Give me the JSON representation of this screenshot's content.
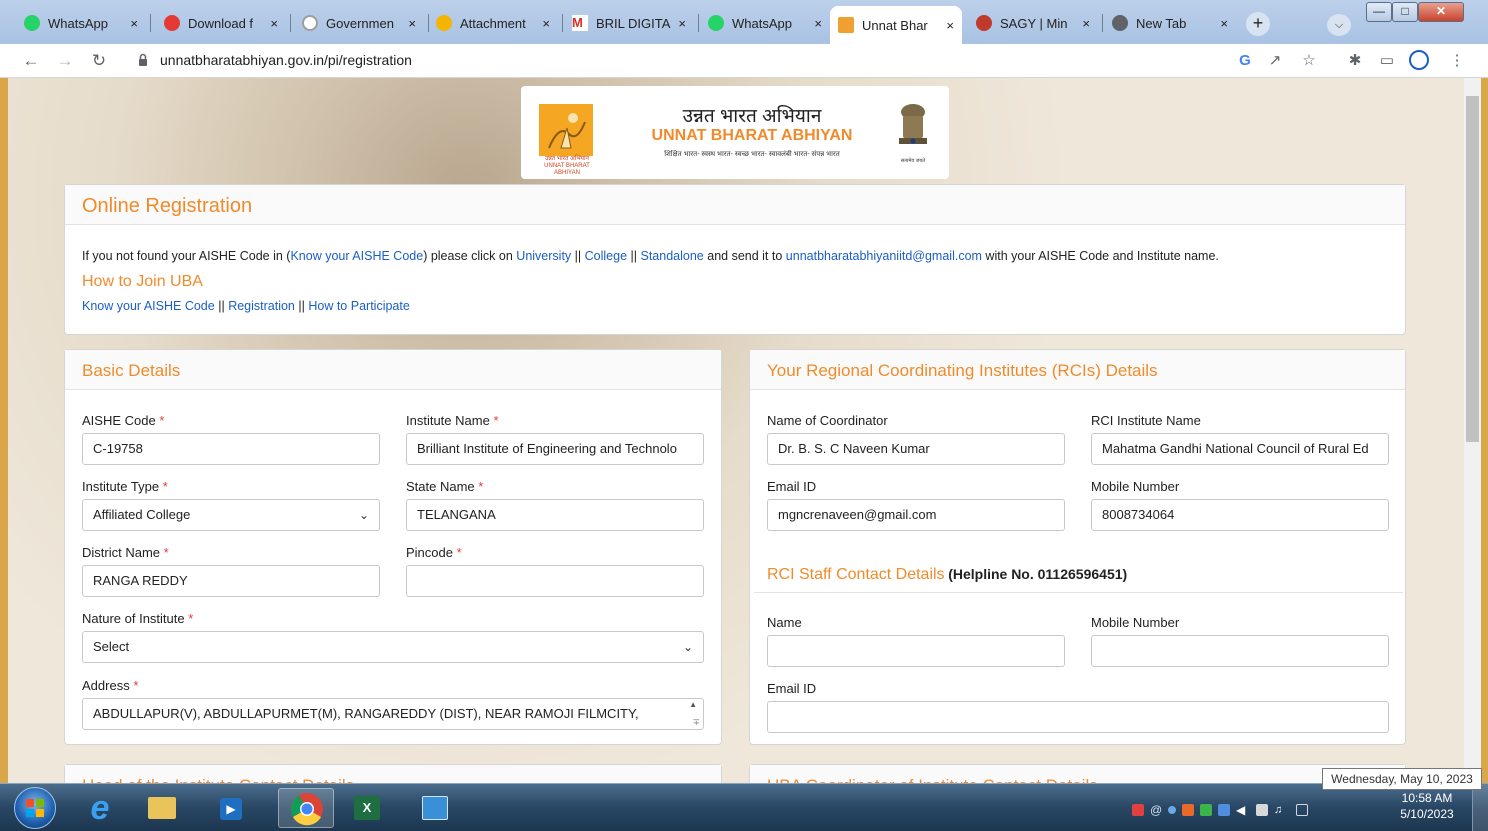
{
  "browser": {
    "tabs": [
      {
        "title": "WhatsApp",
        "favicon_color": "#25d366"
      },
      {
        "title": "Download f",
        "favicon_color": "#e53935"
      },
      {
        "title": "Governmen",
        "favicon_color": "#9e9e9e"
      },
      {
        "title": "Attachment",
        "favicon_color": "#f5b400"
      },
      {
        "title": "BRIL DIGITA",
        "favicon_color": "#d93025"
      },
      {
        "title": "WhatsApp",
        "favicon_color": "#25d366"
      },
      {
        "title": "Unnat Bhar",
        "favicon_color": "#f0a030"
      },
      {
        "title": "SAGY | Min",
        "favicon_color": "#c0392b"
      },
      {
        "title": "New Tab",
        "favicon_color": "#5f6368"
      }
    ],
    "active_tab_index": 6,
    "tab_close": "×",
    "new_tab": "+",
    "url": "unnatbharatabhiyan.gov.in/pi/registration"
  },
  "logo": {
    "hindi_title": "उन्नत भारत अभियान",
    "title": "UNNAT BHARAT ABHIYAN",
    "tagline": "शिक्षित भारत- स्वस्थ भारत- स्वच्छ भारत- स्वावलंबी भारत- संपन्न भारत",
    "left_caption": "उन्नत भारत अभियान",
    "left_caption_en": "UNNAT BHARAT ABHIYAN",
    "emblem_caption": "सत्यमेव जयते"
  },
  "online_registration": {
    "heading": "Online Registration",
    "intro_prefix": "If you not found your AISHE Code in (",
    "intro_link": "Know your AISHE Code",
    "intro_mid": ") please click on",
    "link_university": "University",
    "link_college": "College",
    "link_standalone": "Standalone",
    "separator": "||",
    "intro_send": "and send it to",
    "email": "unnatbharatabhiyaniitd@gmail.com",
    "intro_suffix": "with your AISHE Code and Institute name.",
    "how_to_join": "How to Join UBA",
    "link_know_aishe": "Know your AISHE Code",
    "link_registration": "Registration",
    "link_participate": "How to Participate"
  },
  "basic_details": {
    "heading": "Basic Details",
    "required_mark": "*",
    "aishe_label": "AISHE Code",
    "aishe_value": "C-19758",
    "institute_name_label": "Institute Name",
    "institute_name_value": "Brilliant Institute of Engineering and Technolo",
    "institute_type_label": "Institute Type",
    "institute_type_value": "Affiliated College",
    "state_label": "State Name",
    "state_value": "TELANGANA",
    "district_label": "District Name",
    "district_value": "RANGA REDDY",
    "pincode_label": "Pincode",
    "pincode_value": "",
    "nature_label": "Nature of Institute",
    "nature_value": "Select",
    "address_label": "Address",
    "address_value": "ABDULLAPUR(V), ABDULLAPURMET(M), RANGAREDDY (DIST), NEAR RAMOJI FILMCITY,"
  },
  "rci_details": {
    "heading": "Your Regional Coordinating Institutes (RCIs) Details",
    "coordinator_label": "Name of Coordinator",
    "coordinator_value": "Dr.  B. S. C Naveen Kumar",
    "rci_name_label": "RCI Institute Name",
    "rci_name_value": "Mahatma Gandhi National Council of Rural Ed",
    "email_label": "Email ID",
    "email_value": "mgncrenaveen@gmail.com",
    "mobile_label": "Mobile Number",
    "mobile_value": "8008734064",
    "staff_heading": "RCI Staff Contact Details",
    "helpline": "(Helpline No. 01126596451)",
    "staff_name_label": "Name",
    "staff_mobile_label": "Mobile Number",
    "staff_email_label": "Email ID"
  },
  "sections_below": {
    "head_of_institute": "Head of the Institute Contact Details",
    "uba_coordinator": "UBA Coordinator of Institute Contact Details"
  },
  "taskbar": {
    "time": "10:58 AM",
    "date": "5/10/2023",
    "tooltip": "Wednesday, May 10, 2023"
  }
}
